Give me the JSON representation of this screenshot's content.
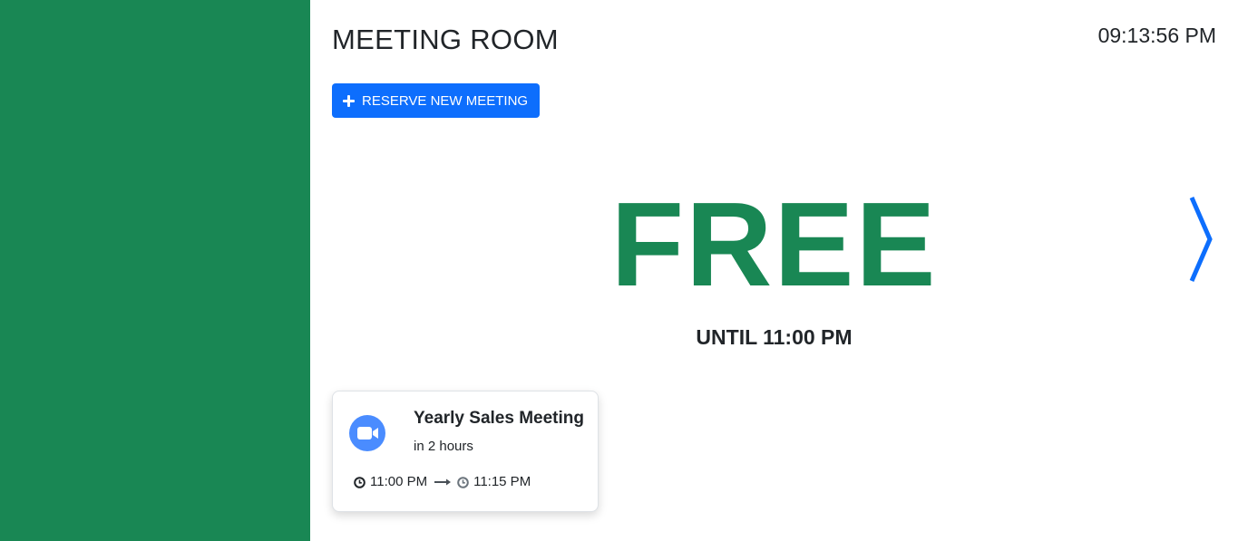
{
  "room": {
    "title": "MEETING ROOM",
    "clock": "09:13:56 PM"
  },
  "actions": {
    "reserve_label": "RESERVE NEW MEETING",
    "reserve_icon": "plus-icon"
  },
  "status": {
    "word": "FREE",
    "until": "UNTIL 11:00 PM",
    "color": "#198754",
    "next_icon": "chevron-right-icon"
  },
  "upcoming": {
    "title": "Yearly Sales Meeting",
    "relative": "in 2 hours",
    "start": "11:00 PM",
    "end": "11:15 PM",
    "icon": "video-camera-icon"
  },
  "colors": {
    "status_bar": "#198754",
    "accent": "#0d6efd",
    "video_icon": "#4a8cff"
  }
}
